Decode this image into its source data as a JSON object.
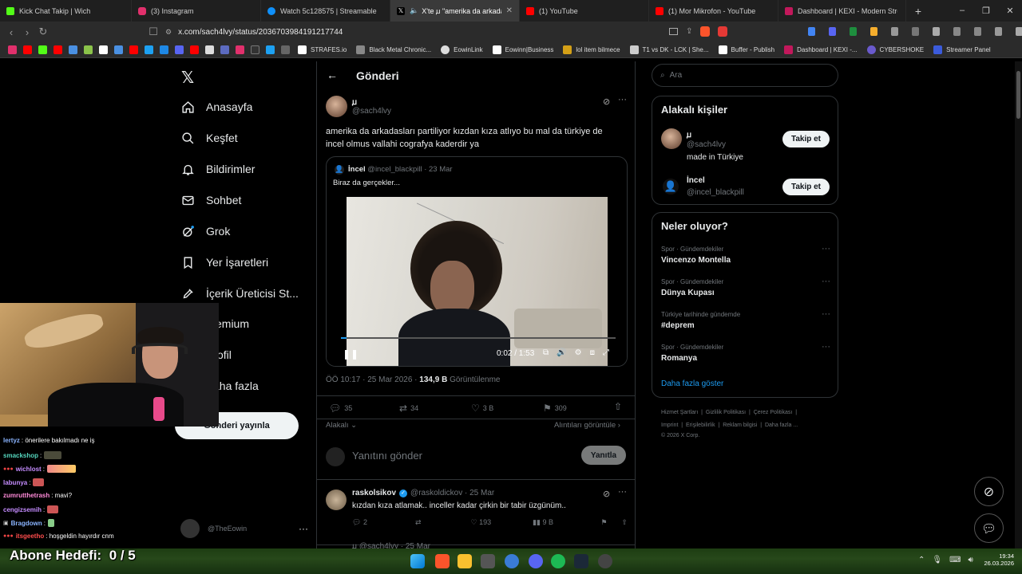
{
  "browser": {
    "tabs": [
      {
        "title": "Kick Chat Takip | Wich",
        "color": "#53fc18"
      },
      {
        "title": "(3) Instagram",
        "color": "#e1306c"
      },
      {
        "title": "Watch 5c128575 | Streamable",
        "color": "#0f90fa"
      },
      {
        "title": "X'te ꙡ \"amerika da arkadaşla",
        "color": "#ffffff"
      },
      {
        "title": "(1) YouTube",
        "color": "#ff0000"
      },
      {
        "title": "(1) Mor Mikrofon - YouTube",
        "color": "#ff0000"
      },
      {
        "title": "Dashboard | KEXI - Modern Stream C",
        "color": "#c2185b"
      }
    ],
    "url": "x.com/sach4lvy/status/2036703984191217744",
    "bookmarks": [
      {
        "label": "STRAFES.io",
        "color": "#ffffff"
      },
      {
        "label": "Black Metal Chronic...",
        "color": "#888888"
      },
      {
        "label": "EowinLink",
        "color": "#dddddd"
      },
      {
        "label": "Eowinn|Business",
        "color": "#ffffff"
      },
      {
        "label": "lol item bilmece",
        "color": "#d4a017"
      },
      {
        "label": "T1 vs DK - LCK | She...",
        "color": "#cccccc"
      },
      {
        "label": "Buffer - Publish",
        "color": "#ffffff"
      },
      {
        "label": "Dashboard | KEXI -...",
        "color": "#c2185b"
      },
      {
        "label": "CYBERSHOKE",
        "color": "#6a5acd"
      },
      {
        "label": "Streamer Panel",
        "color": "#3b5bdb"
      }
    ]
  },
  "nav": {
    "items": [
      {
        "label": "Anasayfa",
        "icon": "home-icon"
      },
      {
        "label": "Keşfet",
        "icon": "search-icon"
      },
      {
        "label": "Bildirimler",
        "icon": "bell-icon"
      },
      {
        "label": "Sohbet",
        "icon": "mail-icon"
      },
      {
        "label": "Grok",
        "icon": "grok-icon"
      },
      {
        "label": "Yer İşaretleri",
        "icon": "bookmark-icon"
      },
      {
        "label": "İçerik Üreticisi St...",
        "icon": "rocket-icon"
      },
      {
        "label": "emium",
        "icon": "premium-icon"
      },
      {
        "label": "ofil",
        "icon": "profile-icon"
      },
      {
        "label": "aha fazla",
        "icon": "more-icon"
      }
    ],
    "post_button": "Gönderi yayınla",
    "account": "@TheEowin"
  },
  "post": {
    "header_title": "Gönderi",
    "author_name": "ꙡ",
    "author_handle": "@sach4lvy",
    "text_line1": "amerika da arkadasları partiliyor kızdan kıza atlıyo bu mal da türkiye de",
    "text_line2": "incel olmus vallahi cografya kaderdir ya",
    "quote": {
      "name": "İncel",
      "handle_date": "@incel_blackpill · 23 Mar",
      "text": "Biraz da gerçekler..."
    },
    "video": {
      "time": "0:02 / 1:53",
      "progress": 0.02
    },
    "meta_time": "ÖÖ 10:17 · 25 Mar 2026 ·",
    "views": "134,9 B",
    "views_label": "Görüntülenme",
    "stats": {
      "replies": "35",
      "reposts": "34",
      "likes": "3 B",
      "bookmarks": "309"
    },
    "sort_label": "Alakalı",
    "quotes_link": "Alıntıları görüntüle",
    "reply_placeholder": "Yanıtını gönder",
    "reply_button": "Yanıtla"
  },
  "reply": {
    "name": "raskolsikov",
    "handle_date": "@raskoldickov · 25 Mar",
    "text": "kızdan kıza atlamak.. inceller kadar çirkin bir tabir üzgünüm..",
    "replies": "2",
    "likes": "193",
    "views": "9 B",
    "next_handle": "ꙡ @sach4lvy · 25 Mar"
  },
  "sidebar": {
    "search_placeholder": "Ara",
    "related_title": "Alakalı kişiler",
    "people": [
      {
        "name": "ꙡ",
        "handle": "@sach4lvy",
        "bio": "made in Türkiye",
        "button": "Takip et"
      },
      {
        "name": "İncel",
        "handle": "@incel_blackpill",
        "bio": "",
        "button": "Takip et"
      }
    ],
    "trends_title": "Neler oluyor?",
    "trends": [
      {
        "category": "Spor · Gündemdekiler",
        "name": "Vincenzo Montella"
      },
      {
        "category": "Spor · Gündemdekiler",
        "name": "Dünya Kupası"
      },
      {
        "category": "Türkiye tarihinde gündemde",
        "name": "#deprem"
      },
      {
        "category": "Spor · Gündemdekiler",
        "name": "Romanya"
      }
    ],
    "show_more": "Daha fazla göster",
    "footer1": [
      "Hizmet Şartları",
      "Gizlilik Politikası",
      "Çerez Politikası"
    ],
    "footer2": [
      "Imprint",
      "Erişilebilirlik",
      "Reklam bilgisi",
      "Daha fazla ..."
    ],
    "copyright": "© 2026 X Corp."
  },
  "chat": {
    "lines": [
      {
        "user": "lertyz",
        "msg": ": önerilere bakılmadı ne iş",
        "color": "#8ab4ff"
      },
      {
        "user": "smackshop",
        "msg": ":",
        "color": "#55d6be"
      },
      {
        "user": "wichlost",
        "msg": ":",
        "color": "#c58cff"
      },
      {
        "user": "labunya",
        "msg": ":",
        "color": "#c58cff"
      },
      {
        "user": "zumrutthetrash",
        "msg": ": mavi?",
        "color": "#ff8ad8"
      },
      {
        "user": "cengizsemih",
        "msg": ":",
        "color": "#c58cff"
      },
      {
        "user": "Bragdown",
        "msg": ":",
        "color": "#8ab4ff"
      },
      {
        "user": "itsgeetho",
        "msg": ": hoşgeldin hayırdır cnm",
        "color": "#ff4d4d"
      }
    ],
    "goal_label": "Abone Hedefi:",
    "goal_value": "0 / 5"
  },
  "taskbar": {
    "time": "19:34",
    "date": "26.03.2026"
  }
}
